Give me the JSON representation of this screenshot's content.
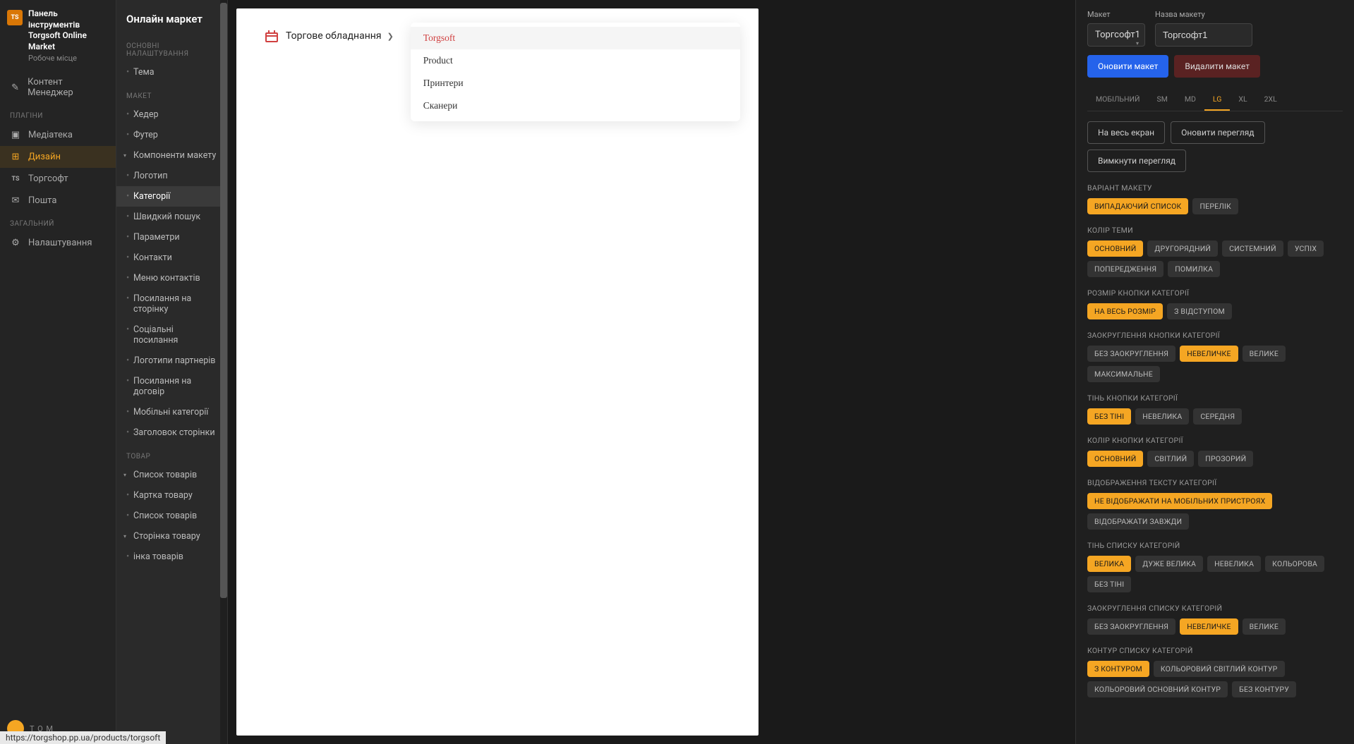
{
  "brand": {
    "icon_text": "TS",
    "title": "Панель інструментів",
    "subtitle": "Torgsoft Online Market",
    "workspace": "Робоче місце"
  },
  "left_nav": {
    "top_item": "Контент Менеджер",
    "plugins_label": "Плагіни",
    "plugins": [
      "Медіатека",
      "Дизайн",
      "Торгсофт",
      "Пошта"
    ],
    "general_label": "Загальний",
    "general": [
      "Налаштування"
    ],
    "bottom_user": "T O M"
  },
  "second": {
    "header": "Онлайн маркет",
    "groups": [
      {
        "label": "Основні налаштування",
        "items": [
          {
            "t": "Тема",
            "leaf": true
          }
        ]
      },
      {
        "label": "Макет",
        "items": [
          {
            "t": "Хедер",
            "leaf": true
          },
          {
            "t": "Футер",
            "leaf": true
          },
          {
            "t": "Компоненти макету",
            "group": true
          },
          {
            "t": "Логотип",
            "leaf": true
          },
          {
            "t": "Категорії",
            "leaf": true,
            "active": true
          },
          {
            "t": "Швидкий пошук",
            "leaf": true
          },
          {
            "t": "Параметри",
            "leaf": true
          },
          {
            "t": "Контакти",
            "leaf": true
          },
          {
            "t": "Меню контактів",
            "leaf": true
          },
          {
            "t": "Посилання на сторінку",
            "leaf": true
          },
          {
            "t": "Соціальні посилання",
            "leaf": true
          },
          {
            "t": "Логотипи партнерів",
            "leaf": true
          },
          {
            "t": "Посилання на договір",
            "leaf": true
          },
          {
            "t": "Мобільні категорії",
            "leaf": true
          },
          {
            "t": "Заголовок сторінки",
            "leaf": true
          }
        ]
      },
      {
        "label": "Товар",
        "items": [
          {
            "t": "Список товарів",
            "group": true
          },
          {
            "t": "Картка товару",
            "leaf": true
          },
          {
            "t": "Список товарів",
            "leaf": true
          },
          {
            "t": "Сторінка товару",
            "group": true
          },
          {
            "t": "інка товарів",
            "leaf": true
          }
        ]
      }
    ]
  },
  "preview": {
    "cat_button": "Торгове обладнання",
    "dropdown": [
      {
        "t": "Torgsoft",
        "sel": true
      },
      {
        "t": "Product"
      },
      {
        "t": "Принтери"
      },
      {
        "t": "Сканери"
      }
    ]
  },
  "right": {
    "layout_label": "Макет",
    "layout_name_label": "Назва макету",
    "layout_select": "Торгсофт1",
    "layout_input": "Торгсофт1",
    "btn_update": "Оновити макет",
    "btn_delete": "Видалити макет",
    "tabs": [
      "Мобільний",
      "SM",
      "MD",
      "LG",
      "XL",
      "2XL"
    ],
    "active_tab": 3,
    "btn_fullscreen": "На весь екран",
    "btn_refresh": "Оновити перегляд",
    "btn_disable": "Вимкнути перегляд",
    "opts": [
      {
        "title": "Варіант макету",
        "chips": [
          "Випадаючий список",
          "Перелік"
        ],
        "active": 0
      },
      {
        "title": "Колір теми",
        "chips": [
          "Основний",
          "Другорядний",
          "Системний",
          "Успіх",
          "Попередження",
          "Помилка"
        ],
        "active": 0
      },
      {
        "title": "Розмір кнопки категорії",
        "chips": [
          "На весь розмір",
          "З відступом"
        ],
        "active": 0
      },
      {
        "title": "Заокруглення кнопки категорії",
        "chips": [
          "Без заокруглення",
          "Невеличке",
          "Велике",
          "Максимальне"
        ],
        "active": 1
      },
      {
        "title": "Тінь кнопки категорії",
        "chips": [
          "Без тіні",
          "Невелика",
          "Середня"
        ],
        "active": 0
      },
      {
        "title": "Колір кнопки категорії",
        "chips": [
          "Основний",
          "Світлий",
          "Прозорий"
        ],
        "active": 0
      },
      {
        "title": "Відображення тексту категорії",
        "chips": [
          "Не відображати на мобільних пристроях",
          "Відображати завжди"
        ],
        "active": 0
      },
      {
        "title": "Тінь списку категорій",
        "chips": [
          "Велика",
          "Дуже велика",
          "Невелика",
          "Кольорова",
          "Без тіні"
        ],
        "active": 0
      },
      {
        "title": "Заокруглення списку категорій",
        "chips": [
          "Без заокруглення",
          "Невеличке",
          "Велике"
        ],
        "active": 1
      },
      {
        "title": "Контур списку категорій",
        "chips": [
          "З контуром",
          "Кольоровий світлий контур",
          "Кольоровий основний контур",
          "Без контуру"
        ],
        "active": 0
      }
    ]
  },
  "status_url": "https://torgshop.pp.ua/products/torgsoft"
}
